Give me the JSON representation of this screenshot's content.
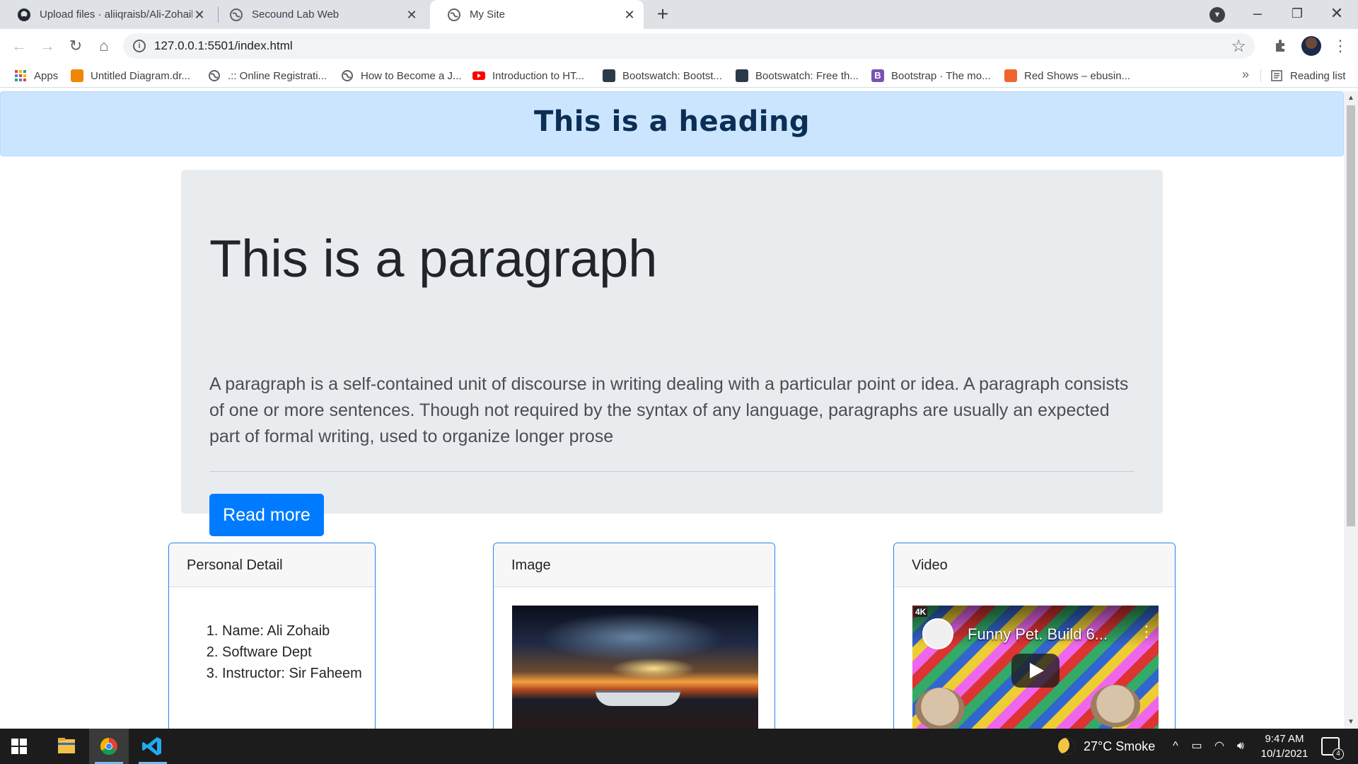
{
  "browser": {
    "tabs": [
      {
        "title": "Upload files · aliiqraisb/Ali-Zohaib",
        "active": false,
        "favicon": "github-icon"
      },
      {
        "title": "Secound Lab Web",
        "active": false,
        "favicon": "globe-icon"
      },
      {
        "title": "My Site",
        "active": true,
        "favicon": "globe-icon"
      }
    ],
    "url": "127.0.0.1:5501/index.html",
    "bookmarks": [
      {
        "label": "Apps",
        "icon": "apps-grid-icon"
      },
      {
        "label": "Untitled Diagram.dr...",
        "icon": "drawio-icon"
      },
      {
        "label": ".:: Online Registrati...",
        "icon": "globe-icon"
      },
      {
        "label": "How to Become a J...",
        "icon": "globe-icon"
      },
      {
        "label": "Introduction to HT...",
        "icon": "youtube-icon"
      },
      {
        "label": "Bootswatch: Bootst...",
        "icon": "bootswatch-icon"
      },
      {
        "label": "Bootswatch: Free th...",
        "icon": "bootswatch-icon"
      },
      {
        "label": "Bootstrap · The mo...",
        "icon": "bootstrap-icon"
      },
      {
        "label": "Red Shows – ebusin...",
        "icon": "redshows-icon"
      }
    ],
    "reading_list": "Reading list",
    "more_bookmarks": "»"
  },
  "page": {
    "header_title": "This is a heading",
    "jumbotron": {
      "title": "This is a paragraph",
      "lead": "A paragraph is a self-contained unit of discourse in writing dealing with a particular point or idea. A paragraph consists of one or more sentences. Though not required by the syntax of any language, paragraphs are usually an expected part of formal writing, used to organize longer prose",
      "button": "Read more"
    },
    "cards": [
      {
        "header": "Personal Detail",
        "items": [
          "Name: Ali Zohaib",
          "Software Dept",
          "Instructor: Sir Faheem"
        ]
      },
      {
        "header": "Image"
      },
      {
        "header": "Video",
        "video_title": "Funny Pet. Build 6...",
        "badge": "4K"
      }
    ]
  },
  "taskbar": {
    "weather": "27°C  Smoke",
    "time": "9:47 AM",
    "date": "10/1/2021",
    "notifications": "4"
  },
  "colors": {
    "header_bg": "#cce5ff",
    "jumbotron_bg": "#e9ecef",
    "primary": "#007bff",
    "card_border": "#2f80ed"
  }
}
